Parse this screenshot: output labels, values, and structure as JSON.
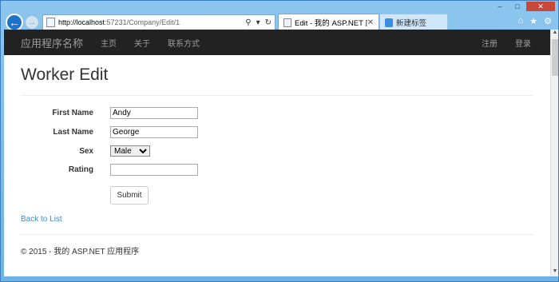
{
  "browser": {
    "address_url_host": "http://localhost",
    "address_url_rest": ":57231/Company/Edit/1",
    "tabs": [
      {
        "label": "Edit - 我的 ASP.NET 应用..."
      },
      {
        "label": "新建标签"
      }
    ]
  },
  "site": {
    "brand": "应用程序名称",
    "nav": [
      "主页",
      "关于",
      "联系方式"
    ],
    "nav_right": [
      "注册",
      "登录"
    ]
  },
  "page": {
    "title": "Worker Edit",
    "fields": {
      "first_name": {
        "label": "First Name",
        "value": "Andy"
      },
      "last_name": {
        "label": "Last Name",
        "value": "George"
      },
      "sex": {
        "label": "Sex",
        "value": "Male",
        "options": [
          "Male"
        ]
      },
      "rating": {
        "label": "Rating",
        "value": ""
      }
    },
    "submit_label": "Submit",
    "back_link": "Back to List",
    "footer": "© 2015 - 我的 ASP.NET 应用程序"
  }
}
